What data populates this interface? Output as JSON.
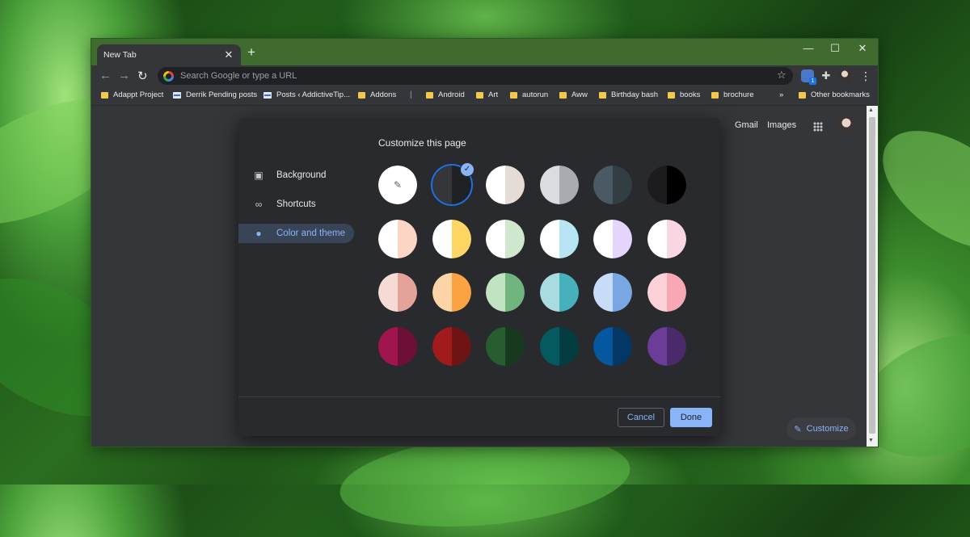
{
  "browser": {
    "tab_title": "New Tab",
    "new_tab_symbol": "+",
    "close_symbol": "✕",
    "window_controls": [
      "—",
      "☐",
      "✕"
    ]
  },
  "toolbar": {
    "omnibox_placeholder": "Search Google or type a URL",
    "extension_badge": "1"
  },
  "bookmarks": [
    {
      "label": "Adappt Project",
      "icon": "folder-icon"
    },
    {
      "label": "Derrik Pending posts",
      "icon": "page-icon"
    },
    {
      "label": "Posts ‹ AddictiveTip...",
      "icon": "page-icon"
    },
    {
      "label": "Addons",
      "icon": "folder-icon"
    },
    {
      "label": "Android",
      "icon": "folder-icon"
    },
    {
      "label": "Art",
      "icon": "folder-icon"
    },
    {
      "label": "autorun",
      "icon": "folder-icon"
    },
    {
      "label": "Aww",
      "icon": "folder-icon"
    },
    {
      "label": "Birthday bash",
      "icon": "folder-icon"
    },
    {
      "label": "books",
      "icon": "folder-icon"
    },
    {
      "label": "brochure",
      "icon": "folder-icon"
    }
  ],
  "bookmarks_overflow": "»",
  "other_bookmarks": "Other bookmarks",
  "ntp": {
    "gmail": "Gmail",
    "images": "Images",
    "customize_label": "Customize"
  },
  "dialog": {
    "title": "Customize this page",
    "sidebar": [
      {
        "label": "Background",
        "icon": "image-icon",
        "active": false
      },
      {
        "label": "Shortcuts",
        "icon": "link-icon",
        "active": false
      },
      {
        "label": "Color and theme",
        "icon": "palette-icon",
        "active": true
      }
    ],
    "swatches": [
      {
        "left": "#ffffff",
        "right": "#ffffff",
        "custom": true
      },
      {
        "left": "#35363a",
        "right": "#202124",
        "selected": true
      },
      {
        "left": "#ffffff",
        "right": "#e6dcd6"
      },
      {
        "left": "#dadce0",
        "right": "#a9abb0"
      },
      {
        "left": "#4a5963",
        "right": "#333d44"
      },
      {
        "left": "#1c1c1e",
        "right": "#000000"
      },
      {
        "left": "#ffffff",
        "right": "#fcd5c5"
      },
      {
        "left": "#ffffff",
        "right": "#fdd663"
      },
      {
        "left": "#ffffff",
        "right": "#cfe8cd"
      },
      {
        "left": "#ffffff",
        "right": "#b7e5f2"
      },
      {
        "left": "#ffffff",
        "right": "#e5d4fb"
      },
      {
        "left": "#ffffff",
        "right": "#f8d6e2"
      },
      {
        "left": "#f5dbd4",
        "right": "#e4a39a"
      },
      {
        "left": "#fcd4a5",
        "right": "#fba342"
      },
      {
        "left": "#c2e3c1",
        "right": "#6fb57d"
      },
      {
        "left": "#a8dce0",
        "right": "#46b0bd"
      },
      {
        "left": "#c7dcf8",
        "right": "#79a7e3"
      },
      {
        "left": "#fcd1d7",
        "right": "#f8a7b5"
      },
      {
        "left": "#a1154f",
        "right": "#6e0f37"
      },
      {
        "left": "#a11b1d",
        "right": "#6e1414"
      },
      {
        "left": "#265e30",
        "right": "#173a1e"
      },
      {
        "left": "#055a60",
        "right": "#033c41"
      },
      {
        "left": "#0557a0",
        "right": "#033766"
      },
      {
        "left": "#6b3d99",
        "right": "#4a2a6b"
      }
    ],
    "cancel_label": "Cancel",
    "done_label": "Done"
  }
}
